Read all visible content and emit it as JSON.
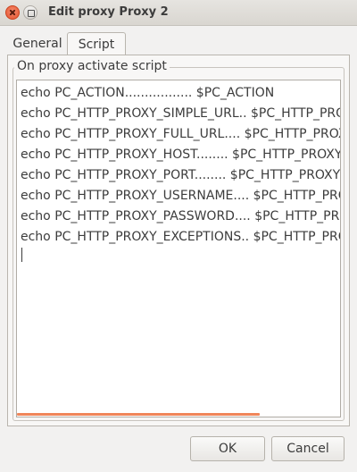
{
  "window": {
    "title": "Edit proxy Proxy 2"
  },
  "tabs": [
    {
      "label": "General",
      "active": false
    },
    {
      "label": "Script",
      "active": true
    }
  ],
  "script": {
    "frame_label": "On proxy activate script",
    "lines": [
      "echo PC_ACTION................. $PC_ACTION",
      "echo PC_HTTP_PROXY_SIMPLE_URL.. $PC_HTTP_PROXY_SIMPLE_URL",
      "echo PC_HTTP_PROXY_FULL_URL.... $PC_HTTP_PROXY_FULL_URL",
      "echo PC_HTTP_PROXY_HOST........ $PC_HTTP_PROXY_HOST",
      "echo PC_HTTP_PROXY_PORT........ $PC_HTTP_PROXY_PORT",
      "echo PC_HTTP_PROXY_USERNAME.... $PC_HTTP_PROXY_USERNAME",
      "echo PC_HTTP_PROXY_PASSWORD.... $PC_HTTP_PROXY_PASSWORD",
      "echo PC_HTTP_PROXY_EXCEPTIONS.. $PC_HTTP_PROXY_EXCEPTIONS"
    ],
    "hscroll_fraction": 0.75
  },
  "buttons": {
    "ok_label": "OK",
    "cancel_label": "Cancel"
  },
  "colors": {
    "accent": "#f0865a",
    "close_button": "#e5532f"
  },
  "icons": {
    "close": "close-icon",
    "maximize": "maximize-icon"
  }
}
